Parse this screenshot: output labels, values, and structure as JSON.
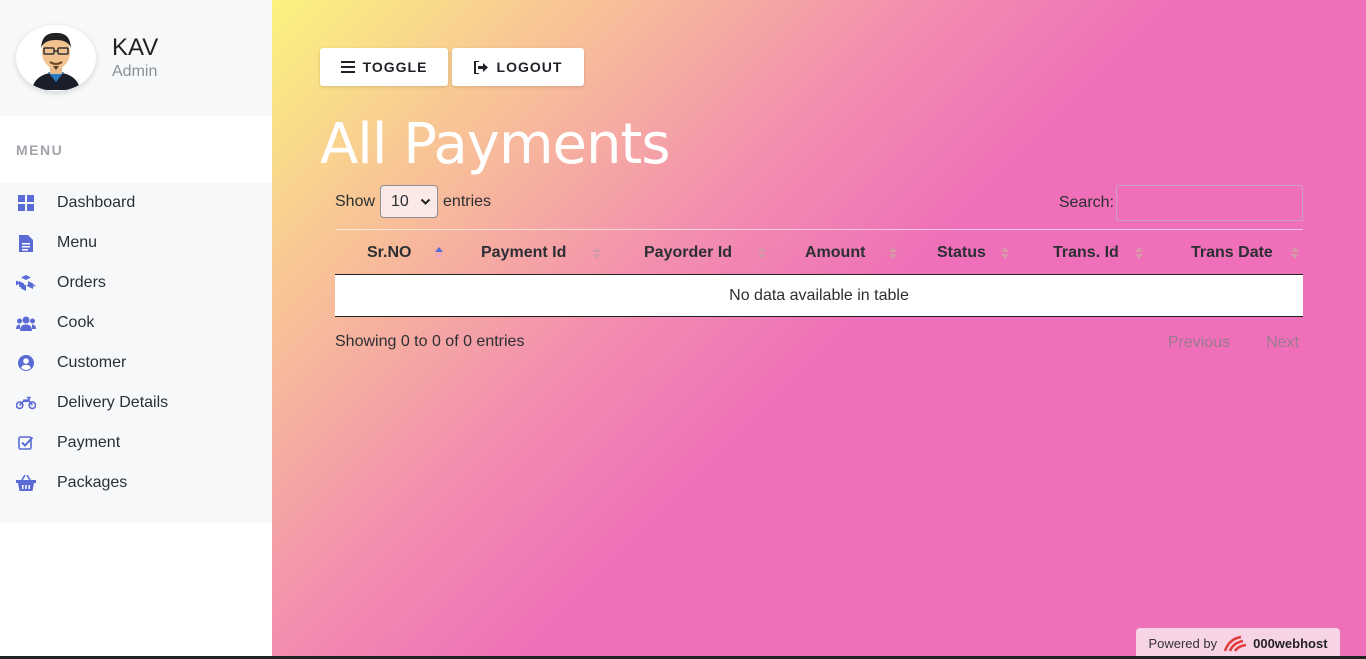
{
  "profile": {
    "name": "KAV",
    "role": "Admin"
  },
  "menu": {
    "heading": "MENU",
    "items": [
      {
        "label": "Dashboard",
        "icon": "dashboard-icon"
      },
      {
        "label": "Menu",
        "icon": "document-icon"
      },
      {
        "label": "Orders",
        "icon": "cubes-icon"
      },
      {
        "label": "Cook",
        "icon": "users-icon"
      },
      {
        "label": "Customer",
        "icon": "user-circle-icon"
      },
      {
        "label": "Delivery Details",
        "icon": "motorcycle-icon"
      },
      {
        "label": "Payment",
        "icon": "check-square-icon"
      },
      {
        "label": "Packages",
        "icon": "basket-icon"
      }
    ]
  },
  "toolbar": {
    "toggle_label": "TOGGLE",
    "logout_label": "LOGOUT"
  },
  "page": {
    "title": "All Payments"
  },
  "table_controls": {
    "show_label": "Show",
    "entries_label": "entries",
    "page_length": "10",
    "search_label": "Search:"
  },
  "table": {
    "columns": [
      "Sr.NO",
      "Payment Id",
      "Payorder Id",
      "Amount",
      "Status",
      "Trans. Id",
      "Trans Date"
    ],
    "empty_message": "No data available in table"
  },
  "footer": {
    "info": "Showing 0 to 0 of 0 entries",
    "previous_label": "Previous",
    "next_label": "Next"
  },
  "badge": {
    "powered_label": "Powered by",
    "brand": "000webhost"
  },
  "colors": {
    "accent": "#5b6bd5",
    "gradient_start": "#fbf37e",
    "gradient_end": "#ef70b8"
  }
}
